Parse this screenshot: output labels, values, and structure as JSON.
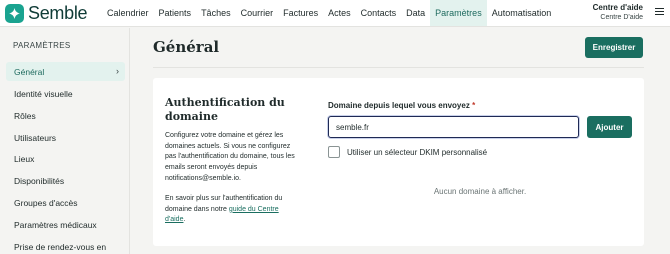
{
  "app": {
    "logo_text": "Semble",
    "colors": {
      "brand": "#1aa390",
      "primary_button": "#1a6e60",
      "active_bg": "#e3f2ee"
    }
  },
  "topnav": {
    "items": [
      {
        "label": "Calendrier"
      },
      {
        "label": "Patients"
      },
      {
        "label": "Tâches"
      },
      {
        "label": "Courrier"
      },
      {
        "label": "Factures"
      },
      {
        "label": "Actes"
      },
      {
        "label": "Contacts"
      },
      {
        "label": "Data"
      },
      {
        "label": "Paramètres",
        "active": true
      },
      {
        "label": "Automatisation"
      }
    ],
    "help_title": "Centre d'aide",
    "help_subtitle": "Centre D'aide",
    "menu_icon": "hamburger-icon"
  },
  "sidebar": {
    "title": "PARAMÈTRES",
    "items": [
      {
        "label": "Général",
        "active": true
      },
      {
        "label": "Identité visuelle"
      },
      {
        "label": "Rôles"
      },
      {
        "label": "Utilisateurs"
      },
      {
        "label": "Lieux"
      },
      {
        "label": "Disponibilités"
      },
      {
        "label": "Groupes d'accès"
      },
      {
        "label": "Paramètres médicaux"
      },
      {
        "label": "Prise de rendez-vous en"
      }
    ]
  },
  "main": {
    "title": "Général",
    "save_label": "Enregistrer",
    "auth_card": {
      "title": "Authentification du domaine",
      "description": "Configurez votre domaine et gérez les domaines actuels. Si vous ne configurez pas l'authentification du domaine, tous les emails seront envoyés depuis notifications@semble.io.",
      "more_prefix": "En savoir plus sur l'authentification du domaine dans notre ",
      "more_link": "guide du Centre d'aide",
      "more_suffix": ".",
      "field_label": "Domaine depuis lequel vous envoyez",
      "required_mark": "*",
      "domain_value": "semble.fr",
      "add_label": "Ajouter",
      "dkim_label": "Utiliser un sélecteur DKIM personnalisé",
      "dkim_checked": false,
      "empty_message": "Aucun domaine à afficher."
    }
  }
}
